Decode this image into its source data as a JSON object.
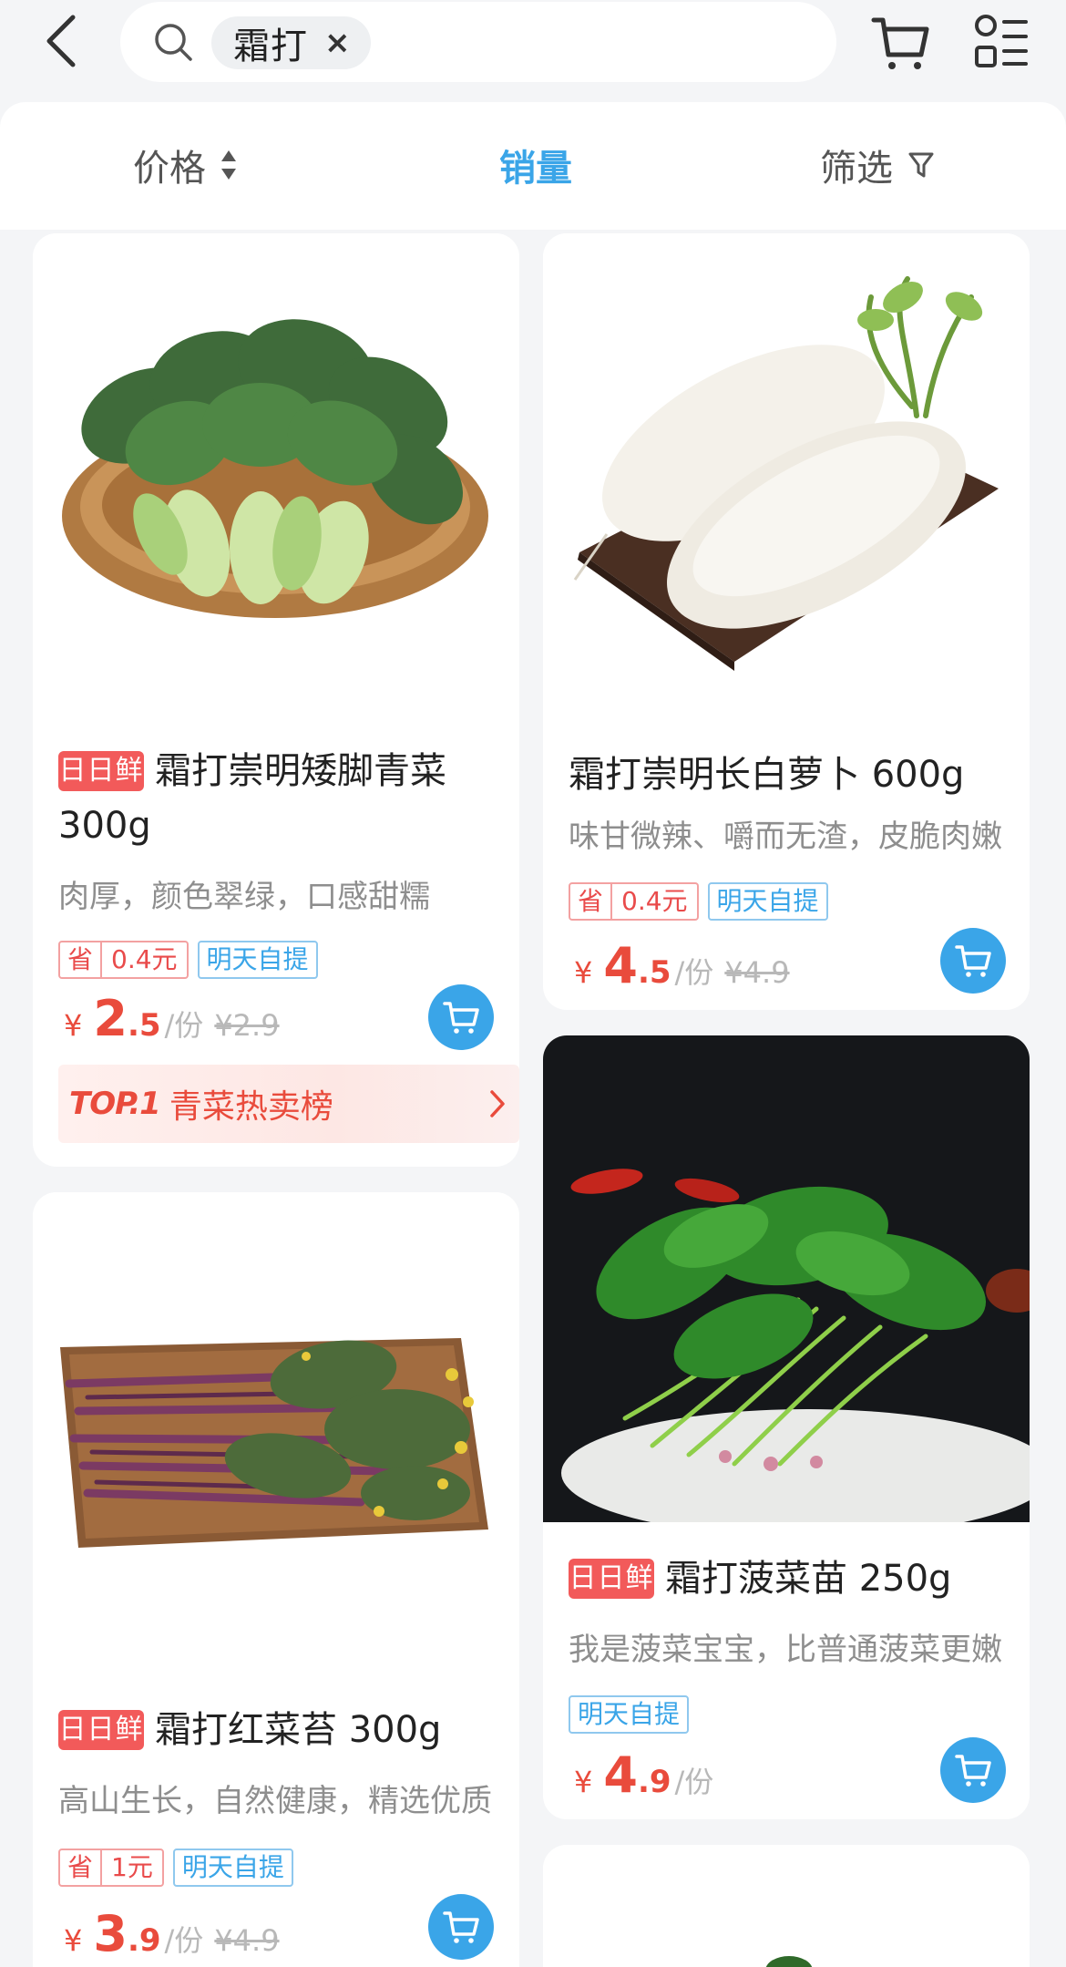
{
  "header": {
    "search_term": "霜打",
    "chip_close": "×"
  },
  "sortbar": {
    "price_label": "价格",
    "sales_label": "销量",
    "filter_label": "筛选",
    "active": "销量",
    "active_color": "#3aa5e8"
  },
  "colors": {
    "accent_blue": "#3aa5e8",
    "price_red": "#e94b3c",
    "badge_red": "#f25a5a"
  },
  "products": [
    {
      "badge": "日日鲜",
      "name": "霜打崇明矮脚青菜 300g",
      "desc": "肉厚，颜色翠绿，口感甜糯",
      "save_tag": [
        "省",
        "0.4元"
      ],
      "pickup_tag": "明天自提",
      "price_yen": "¥",
      "price_int": "2",
      "price_dec": ".5",
      "unit": "/份",
      "orig_price": "¥2.9",
      "rank": {
        "top": "TOP.1",
        "text": "青菜热卖榜"
      },
      "image": "bok-choy"
    },
    {
      "badge": "",
      "name": "霜打崇明长白萝卜 600g",
      "desc": "味甘微辣、嚼而无渣，皮脆肉嫩",
      "save_tag": [
        "省",
        "0.4元"
      ],
      "pickup_tag": "明天自提",
      "price_yen": "¥",
      "price_int": "4",
      "price_dec": ".5",
      "unit": "/份",
      "orig_price": "¥4.9",
      "image": "white-radish"
    },
    {
      "badge": "日日鲜",
      "name": "霜打红菜苔 300g",
      "desc": "高山生长，自然健康，精选优质",
      "save_tag": [
        "省",
        "1元"
      ],
      "pickup_tag": "明天自提",
      "price_yen": "¥",
      "price_int": "3",
      "price_dec": ".9",
      "unit": "/份",
      "orig_price": "¥4.9",
      "image": "red-choy-sum"
    },
    {
      "badge": "日日鲜",
      "name": "霜打菠菜苗 250g",
      "desc": "我是菠菜宝宝，比普通菠菜更嫩",
      "pickup_tag": "明天自提",
      "price_yen": "¥",
      "price_int": "4",
      "price_dec": ".9",
      "unit": "/份",
      "image": "baby-spinach"
    }
  ]
}
